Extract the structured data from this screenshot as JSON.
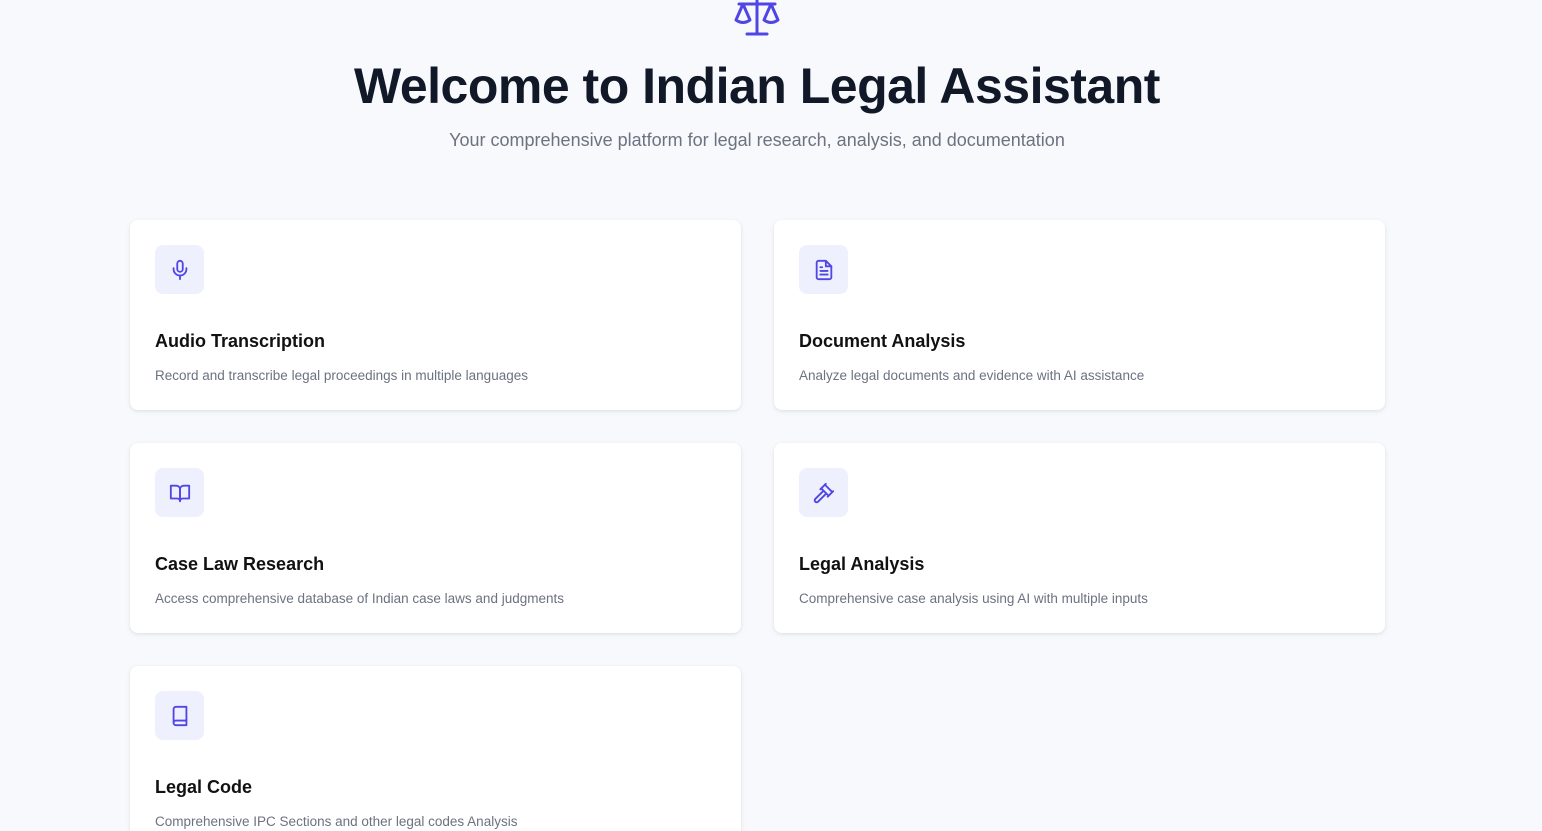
{
  "hero": {
    "icon": "scale-icon",
    "title": "Welcome to Indian Legal Assistant",
    "subtitle": "Your comprehensive platform for legal research, analysis, and documentation"
  },
  "colors": {
    "accent": "#4f46e5",
    "icon_bg": "#eef0fd",
    "title": "#111827",
    "muted": "#6b7280",
    "background": "#f8f9fc"
  },
  "cards": [
    {
      "icon": "microphone-icon",
      "title": "Audio Transcription",
      "description": "Record and transcribe legal proceedings in multiple languages"
    },
    {
      "icon": "document-icon",
      "title": "Document Analysis",
      "description": "Analyze legal documents and evidence with AI assistance"
    },
    {
      "icon": "open-book-icon",
      "title": "Case Law Research",
      "description": "Access comprehensive database of Indian case laws and judgments"
    },
    {
      "icon": "gavel-icon",
      "title": "Legal Analysis",
      "description": "Comprehensive case analysis using AI with multiple inputs"
    },
    {
      "icon": "book-icon",
      "title": "Legal Code",
      "description": "Comprehensive IPC Sections and other legal codes Analysis"
    }
  ]
}
